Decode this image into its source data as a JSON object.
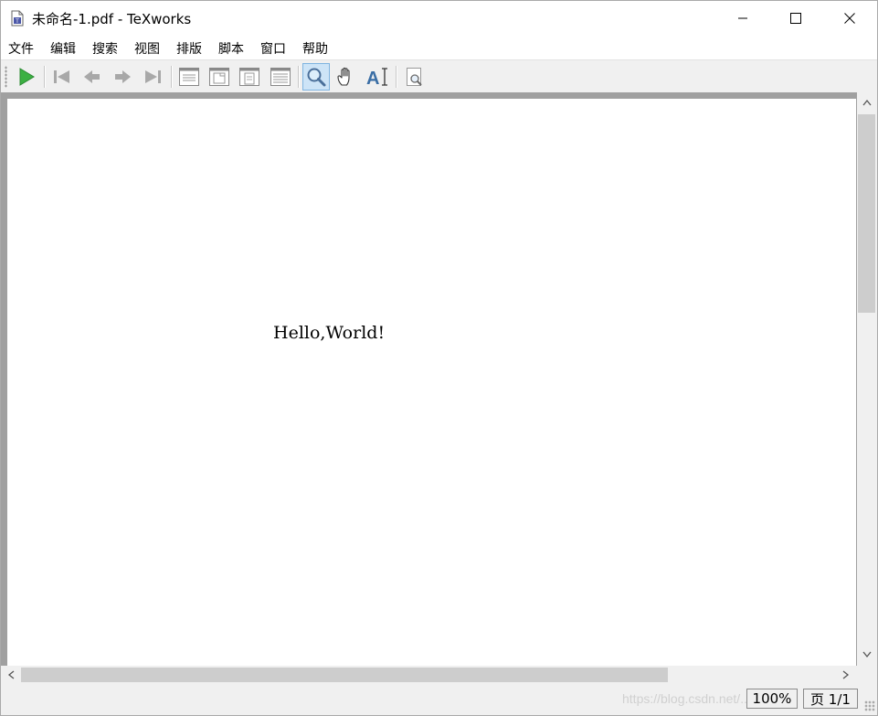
{
  "window": {
    "title": "未命名-1.pdf - TeXworks",
    "minimize_icon": "minimize-icon",
    "maximize_icon": "maximize-icon",
    "close_icon": "close-icon"
  },
  "menu": {
    "items": [
      {
        "label": "文件"
      },
      {
        "label": "编辑"
      },
      {
        "label": "搜索"
      },
      {
        "label": "视图"
      },
      {
        "label": "排版"
      },
      {
        "label": "脚本"
      },
      {
        "label": "窗口"
      },
      {
        "label": "帮助"
      }
    ]
  },
  "toolbar": {
    "buttons": [
      {
        "icon": "typeset-play-icon"
      },
      {
        "icon": "first-page-icon"
      },
      {
        "icon": "previous-page-icon"
      },
      {
        "icon": "next-page-icon"
      },
      {
        "icon": "last-page-icon"
      },
      {
        "icon": "actual-size-icon"
      },
      {
        "icon": "fit-width-icon"
      },
      {
        "icon": "fit-page-icon"
      },
      {
        "icon": "fit-content-icon"
      },
      {
        "icon": "magnify-icon",
        "active": true
      },
      {
        "icon": "hand-scroll-icon"
      },
      {
        "icon": "select-text-icon"
      },
      {
        "icon": "zoom-page-icon"
      }
    ],
    "accent": "#3cb043"
  },
  "document": {
    "text": "Hello,World!"
  },
  "status": {
    "zoom": "100%",
    "page": "页 1/1",
    "watermark": "https://blog.csdn.net/..."
  }
}
